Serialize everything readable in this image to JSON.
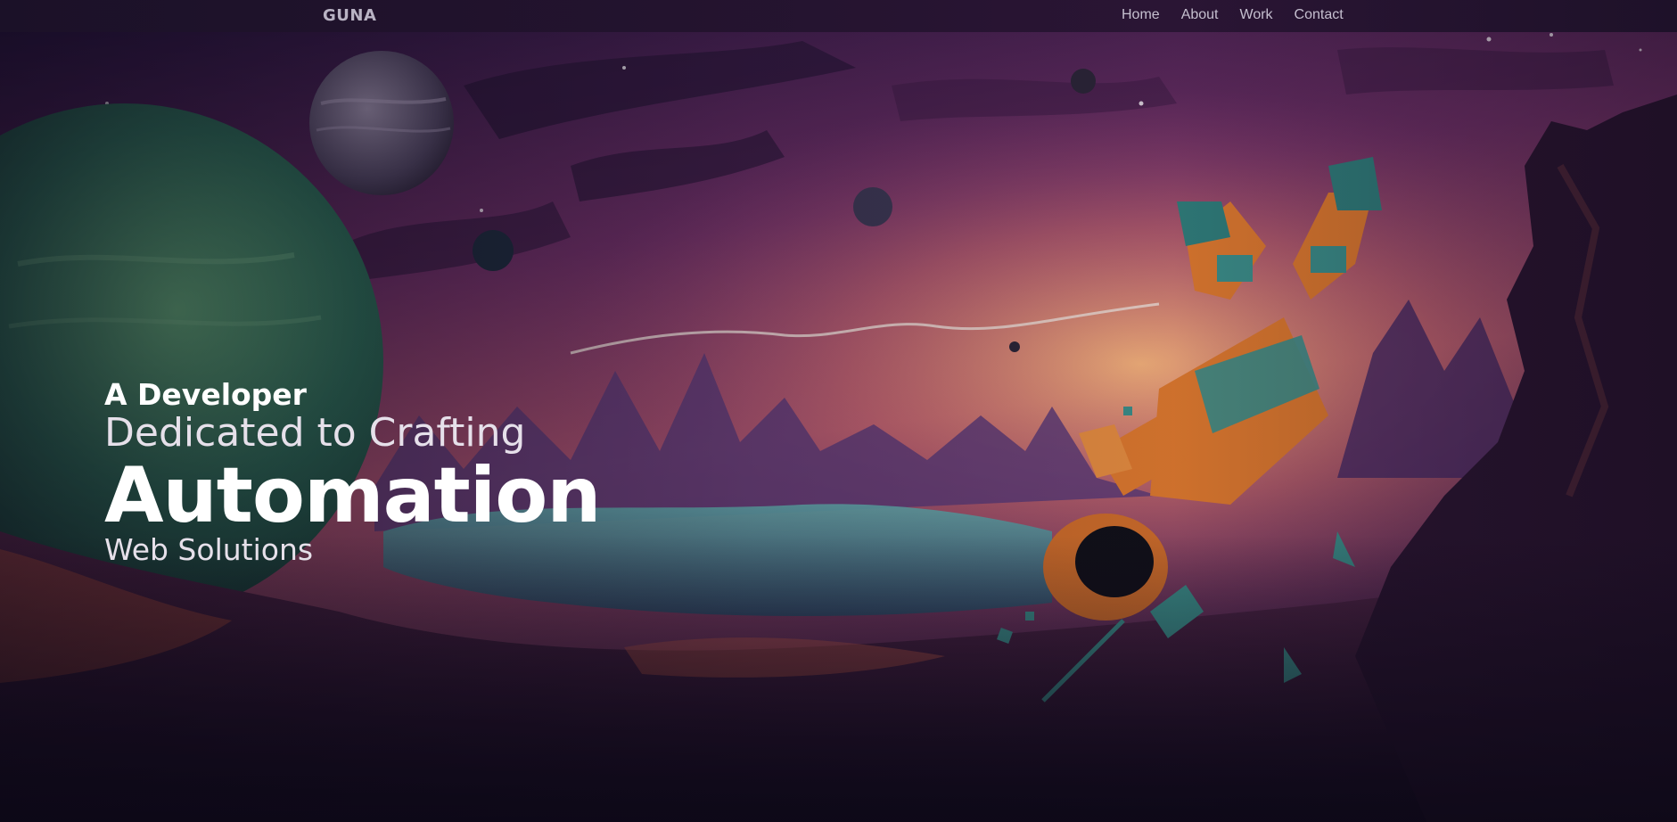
{
  "nav": {
    "brand": "GUNA",
    "links": [
      {
        "label": "Home"
      },
      {
        "label": "About"
      },
      {
        "label": "Work"
      },
      {
        "label": "Contact"
      }
    ]
  },
  "hero": {
    "line1": "A Developer",
    "line2": "Dedicated to Crafting",
    "line3": "Automation",
    "line4": "Web Solutions"
  },
  "colors": {
    "nav_bg": "#1b1128",
    "nav_text": "#c5bfcf",
    "sky_top": "#3a1b4f",
    "sky_mid": "#8a3f6e",
    "sky_glow": "#e9a070",
    "planet_green": "#3f8a63",
    "astronaut_orange": "#d8762e",
    "astronaut_teal": "#3a8a86"
  }
}
